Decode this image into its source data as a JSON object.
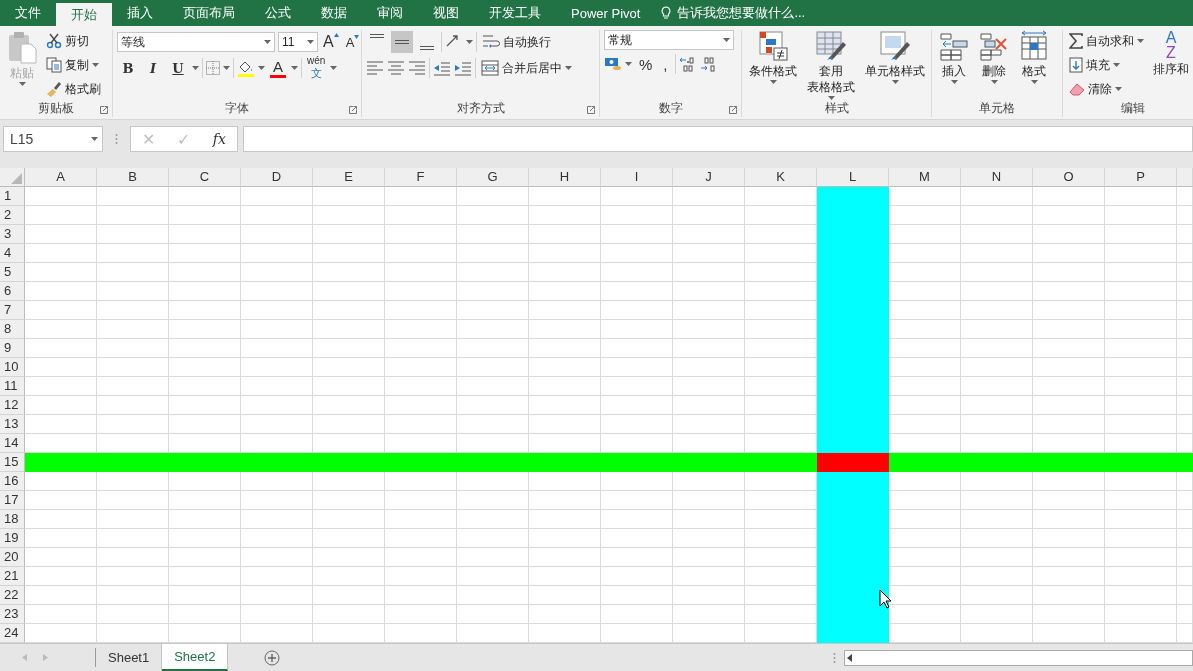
{
  "menu_tabs": [
    {
      "label": "文件",
      "selected": false
    },
    {
      "label": "开始",
      "selected": true
    },
    {
      "label": "插入",
      "selected": false
    },
    {
      "label": "页面布局",
      "selected": false
    },
    {
      "label": "公式",
      "selected": false
    },
    {
      "label": "数据",
      "selected": false
    },
    {
      "label": "审阅",
      "selected": false
    },
    {
      "label": "视图",
      "selected": false
    },
    {
      "label": "开发工具",
      "selected": false
    },
    {
      "label": "Power Pivot",
      "selected": false
    }
  ],
  "tell_me": {
    "placeholder": "告诉我您想要做什么..."
  },
  "clipboard": {
    "title": "剪贴板",
    "paste": {
      "label": "粘贴",
      "disabled": true
    },
    "cut": "剪切",
    "copy": "复制",
    "format_painter": "格式刷"
  },
  "font": {
    "title": "字体",
    "font_name": "等线",
    "font_size": "11",
    "grow": "A",
    "shrink": "A",
    "bold": "B",
    "italic": "I",
    "underline": "U",
    "font_color": "A",
    "phonetic_top": "wén",
    "phonetic_bottom": "文"
  },
  "alignment": {
    "title": "对齐方式",
    "vertical_align": [
      {
        "selected": false
      },
      {
        "selected": true
      },
      {
        "selected": false
      }
    ],
    "wrap_text": "自动换行",
    "merge_center": "合并后居中"
  },
  "number": {
    "title": "数字",
    "format": "常规",
    "percent": "%",
    "comma": ","
  },
  "styles": {
    "title": "样式",
    "conditional": "条件格式",
    "table_format": [
      "套用",
      "表格格式"
    ],
    "cell_styles": "单元格样式"
  },
  "cells": {
    "title": "单元格",
    "insert": "插入",
    "delete": "删除",
    "format": "格式"
  },
  "editing": {
    "title": "编辑",
    "autosum": "自动求和",
    "fill": "填充",
    "clear": "清除",
    "sort": "排序和",
    "sort_glyphs": [
      "A",
      "Z"
    ]
  },
  "formula_bar": {
    "name_box": "L15",
    "cancel": "✕",
    "enter": "✓",
    "fx": "fx",
    "disabled": true
  },
  "columns": [
    {
      "label": "A",
      "highlighted": false
    },
    {
      "label": "B",
      "highlighted": false
    },
    {
      "label": "C",
      "highlighted": false
    },
    {
      "label": "D",
      "highlighted": false
    },
    {
      "label": "E",
      "highlighted": false
    },
    {
      "label": "F",
      "highlighted": false
    },
    {
      "label": "G",
      "highlighted": false
    },
    {
      "label": "H",
      "highlighted": false
    },
    {
      "label": "I",
      "highlighted": false
    },
    {
      "label": "J",
      "highlighted": false
    },
    {
      "label": "K",
      "highlighted": false
    },
    {
      "label": "L",
      "highlighted": true
    },
    {
      "label": "M",
      "highlighted": false
    },
    {
      "label": "N",
      "highlighted": false
    },
    {
      "label": "O",
      "highlighted": false
    },
    {
      "label": "P",
      "highlighted": false
    }
  ],
  "rows": [
    {
      "label": "1",
      "highlighted": false
    },
    {
      "label": "2",
      "highlighted": false
    },
    {
      "label": "3",
      "highlighted": false
    },
    {
      "label": "4",
      "highlighted": false
    },
    {
      "label": "5",
      "highlighted": false
    },
    {
      "label": "6",
      "highlighted": false
    },
    {
      "label": "7",
      "highlighted": false
    },
    {
      "label": "8",
      "highlighted": false
    },
    {
      "label": "9",
      "highlighted": false
    },
    {
      "label": "10",
      "highlighted": false
    },
    {
      "label": "11",
      "highlighted": false
    },
    {
      "label": "12",
      "highlighted": false
    },
    {
      "label": "13",
      "highlighted": false
    },
    {
      "label": "14",
      "highlighted": false
    },
    {
      "label": "15",
      "highlighted": true
    },
    {
      "label": "16",
      "highlighted": false
    },
    {
      "label": "17",
      "highlighted": false
    },
    {
      "label": "18",
      "highlighted": false
    },
    {
      "label": "19",
      "highlighted": false
    },
    {
      "label": "20",
      "highlighted": false
    },
    {
      "label": "21",
      "highlighted": false
    },
    {
      "label": "22",
      "highlighted": false
    },
    {
      "label": "23",
      "highlighted": false
    },
    {
      "label": "24",
      "highlighted": false
    }
  ],
  "sheets": [
    {
      "label": "Sheet1",
      "selected": false
    },
    {
      "label": "Sheet2",
      "selected": true
    }
  ]
}
